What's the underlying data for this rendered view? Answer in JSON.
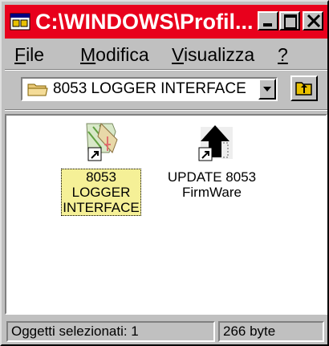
{
  "window": {
    "title": "C:\\WINDOWS\\Profil...",
    "title_icon": "folder-window-icon",
    "colors": {
      "titlebar": "#e8001c",
      "selection": "#f5f097"
    }
  },
  "menu": {
    "file": "File",
    "modifica": "Modifica",
    "visualizza": "Visualizza",
    "help": "?"
  },
  "toolbar": {
    "address": "8053 LOGGER INTERFACE",
    "up_icon": "up-one-level-icon"
  },
  "items": [
    {
      "line1": "8053",
      "line2": "LOGGER",
      "line3": "INTERFACE",
      "icon": "logger-shortcut-icon",
      "selected": true
    },
    {
      "line1": "UPDATE 8053",
      "line2": "FirmWare",
      "icon": "update-shortcut-icon",
      "selected": false
    }
  ],
  "status": {
    "selected": "Oggetti selezionati: 1",
    "size": "266 byte"
  }
}
